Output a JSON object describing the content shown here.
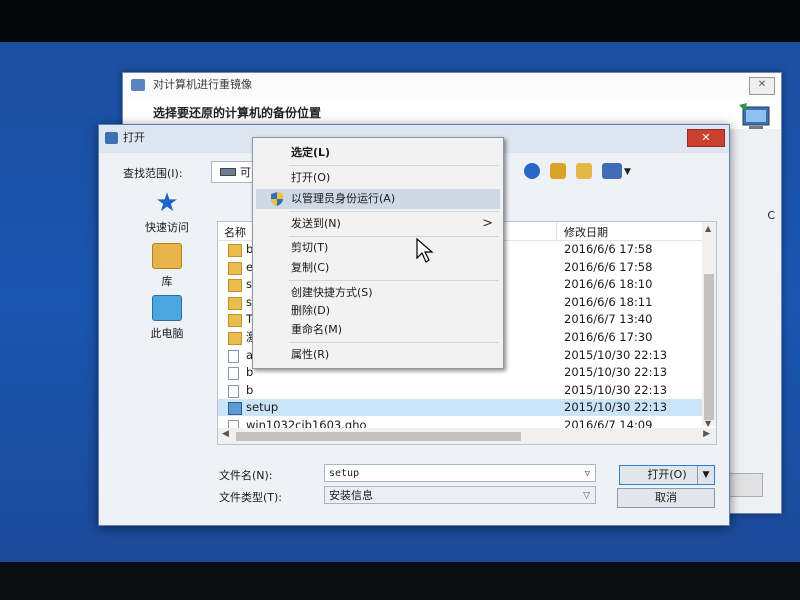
{
  "background_window": {
    "title": "对计算机进行重镜像",
    "heading": "选择要还原的计算机的备份位置",
    "close_glyph": "✕",
    "side_label": "C"
  },
  "open_dialog": {
    "title": "打开",
    "close_glyph": "✕",
    "look_in_label": "查找范围(I):",
    "look_in_value": "可",
    "places": [
      {
        "label": "快速访问",
        "icon": "quick-access-star-icon"
      },
      {
        "label": "库",
        "icon": "library-icon"
      },
      {
        "label": "此电脑",
        "icon": "this-pc-icon"
      }
    ],
    "columns": {
      "name": "名称",
      "date": "修改日期"
    },
    "files": [
      {
        "name": "b",
        "date": "2016/6/6 17:58",
        "type": "folder"
      },
      {
        "name": "e",
        "date": "2016/6/6 17:58",
        "type": "folder"
      },
      {
        "name": "s",
        "date": "2016/6/6 18:10",
        "type": "folder"
      },
      {
        "name": "s",
        "date": "2016/6/6 18:11",
        "type": "folder"
      },
      {
        "name": "T",
        "date": "2016/6/7 13:40",
        "type": "folder"
      },
      {
        "name": "激",
        "date": "2016/6/6 17:30",
        "type": "folder"
      },
      {
        "name": "a",
        "date": "2015/10/30 22:13",
        "type": "file"
      },
      {
        "name": "b",
        "date": "2015/10/30 22:13",
        "type": "file"
      },
      {
        "name": "b",
        "date": "2015/10/30 22:13",
        "type": "file"
      },
      {
        "name": "setup",
        "date": "2015/10/30 22:13",
        "type": "setup",
        "selected": true
      },
      {
        "name": "win1032cjb1603.gho",
        "date": "2016/6/7 14:09",
        "type": "file"
      }
    ],
    "filename_label": "文件名(N):",
    "filename_value": "setup",
    "filetype_label": "文件类型(T):",
    "filetype_value": "安装信息",
    "open_button": "打开(O)",
    "cancel_button": "取消"
  },
  "context_menu": {
    "items": [
      {
        "label": "选定(L)",
        "bold": true
      },
      {
        "label": "打开(O)"
      },
      {
        "label": "以管理员身份运行(A)",
        "highlighted": true,
        "icon": "uac-shield-icon"
      },
      {
        "label": "发送到(N)",
        "submenu": true
      },
      {
        "label": "剪切(T)"
      },
      {
        "label": "复制(C)"
      },
      {
        "label": "创建快捷方式(S)"
      },
      {
        "label": "删除(D)"
      },
      {
        "label": "重命名(M)"
      },
      {
        "label": "属性(R)"
      }
    ],
    "submenu_arrow": ">"
  },
  "colors": {
    "desktop": "#1a55b0",
    "selection": "#cbe4f7",
    "menu_highlight": "#cfd9e6",
    "close_button": "#c9402f"
  }
}
